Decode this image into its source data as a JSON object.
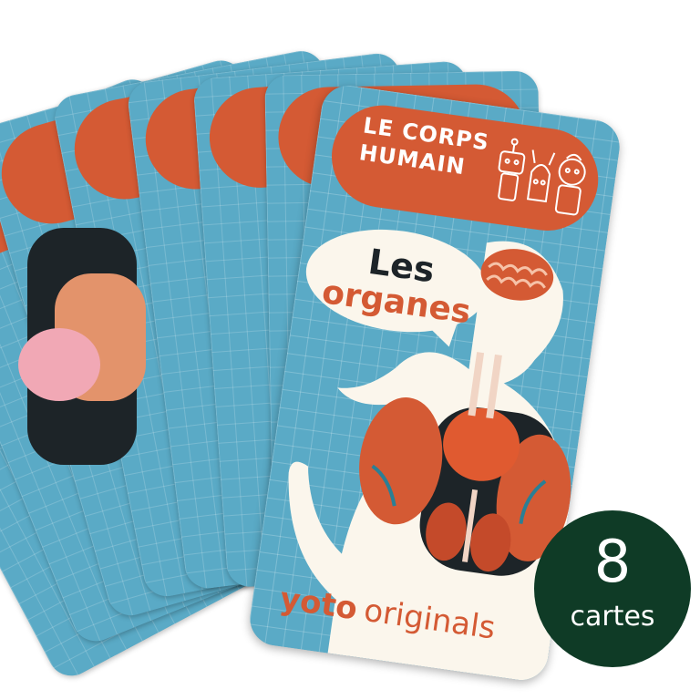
{
  "product": {
    "series_title_line1": "LE CORPS",
    "series_title_line2": "HUMAIN",
    "card_title_line1": "Les",
    "card_title_line2": "organes",
    "brand_part1": "yoto",
    "brand_part2": "originals"
  },
  "badge": {
    "count": "8",
    "unit": "cartes"
  },
  "colors": {
    "card_blue": "#5aaac6",
    "banner_orange": "#d45a34",
    "badge_green": "#0f3b26",
    "bubble_cream": "#fbf6ec",
    "ink": "#1d2428"
  },
  "back_cards_visible": 7
}
